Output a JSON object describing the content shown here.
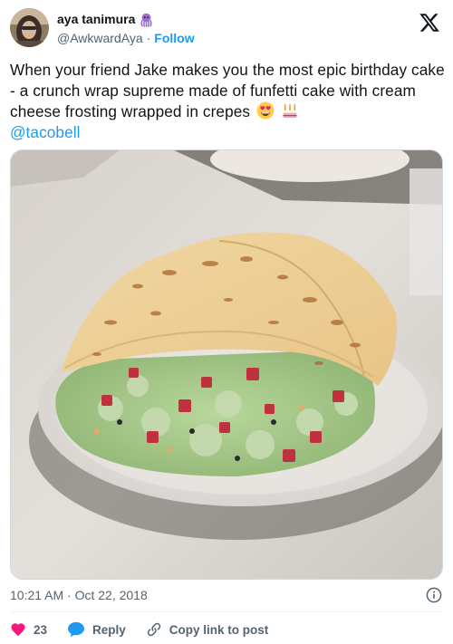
{
  "author": {
    "display_name": "aya tanimura",
    "handle": "@AwkwardAya",
    "separator": "·",
    "follow_label": "Follow",
    "name_icon": "octopus-icon"
  },
  "tweet": {
    "text": "When your friend Jake makes you the most epic birthday cake - a crunch wrap supreme made of funfetti cake with cream cheese frosting wrapped in crepes",
    "emojis": [
      "heart-eyes-emoji",
      "birthday-cake-emoji"
    ],
    "mention": "@tacobell"
  },
  "media": {
    "subject_icon": "crunchwrap-cake-photo"
  },
  "meta": {
    "timestamp": "10:21 AM · Oct 22, 2018"
  },
  "actions": {
    "like_count": "23",
    "reply_label": "Reply",
    "copy_link_label": "Copy link to post"
  },
  "colors": {
    "accent": "#1d9bf0",
    "like": "#f91880",
    "text": "#0f1419",
    "muted": "#536471",
    "border": "#cfd9de"
  }
}
